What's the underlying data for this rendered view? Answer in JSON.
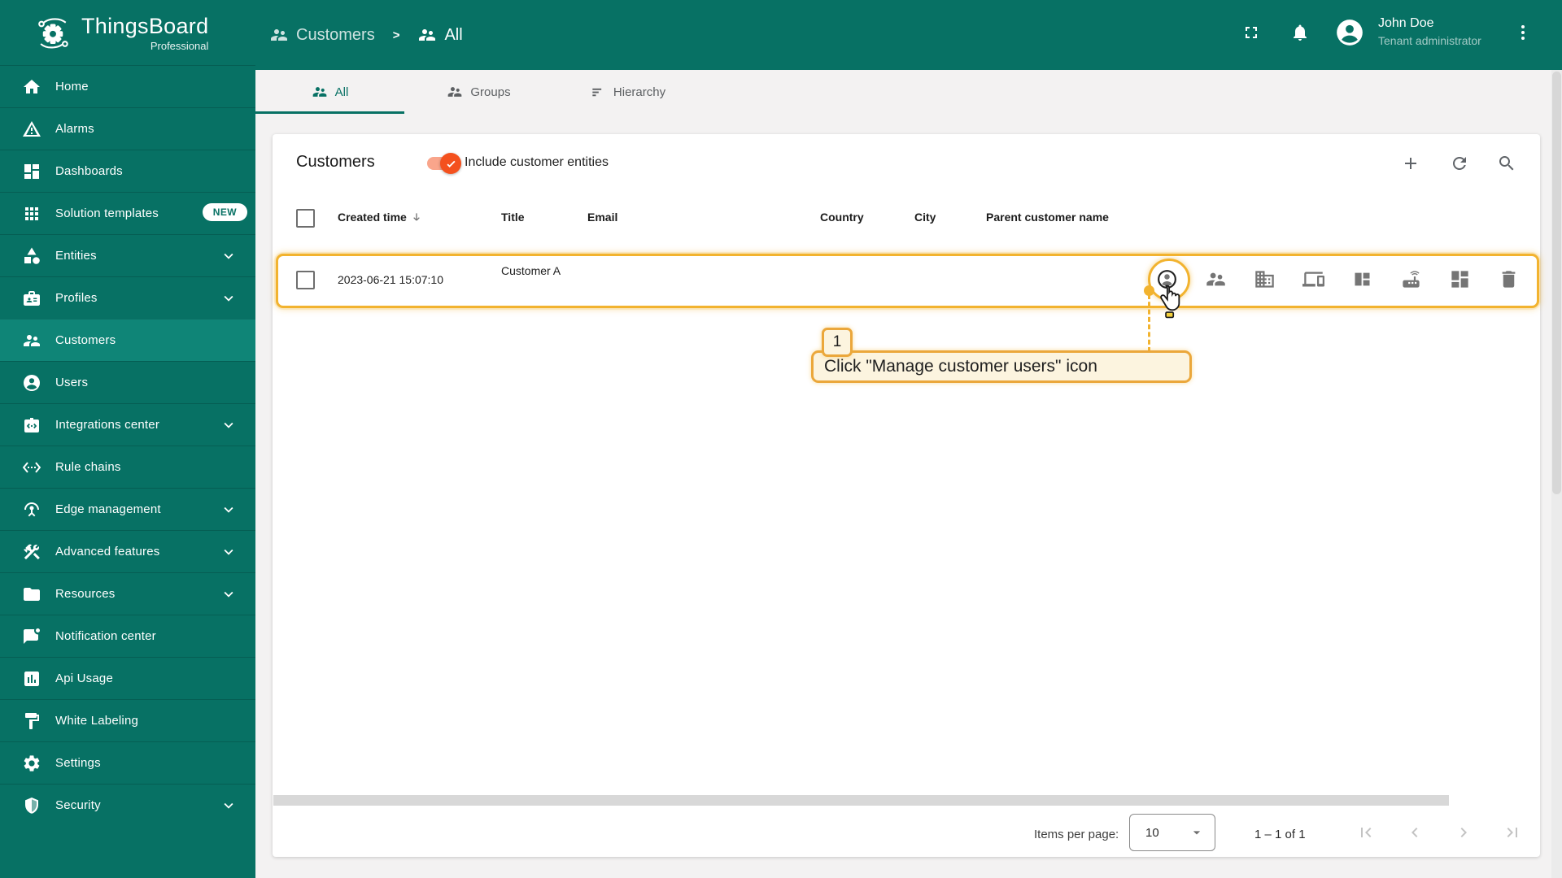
{
  "app": {
    "name": "ThingsBoard",
    "edition": "Professional"
  },
  "colors": {
    "teal": "#077164",
    "teal_active": "#0f8577",
    "accent_orange": "#f4511e",
    "toggle_track": "#f9a58b",
    "highlight_gold": "#f2b32f",
    "annotation_bg": "#fcf4df",
    "annotation_border": "#eba73b"
  },
  "sidebar": {
    "items": [
      {
        "label": "Home",
        "icon": "home-icon"
      },
      {
        "label": "Alarms",
        "icon": "warning-icon"
      },
      {
        "label": "Dashboards",
        "icon": "dashboard-icon"
      },
      {
        "label": "Solution templates",
        "icon": "apps-icon",
        "badge": "NEW"
      },
      {
        "label": "Entities",
        "icon": "shapes-icon",
        "expandable": true
      },
      {
        "label": "Profiles",
        "icon": "badge-icon",
        "expandable": true
      },
      {
        "label": "Customers",
        "icon": "people-icon",
        "active": true
      },
      {
        "label": "Users",
        "icon": "person-circle-icon"
      },
      {
        "label": "Integrations center",
        "icon": "integration-icon",
        "expandable": true
      },
      {
        "label": "Rule chains",
        "icon": "ethernet-icon"
      },
      {
        "label": "Edge management",
        "icon": "antenna-icon",
        "expandable": true
      },
      {
        "label": "Advanced features",
        "icon": "tools-icon",
        "expandable": true
      },
      {
        "label": "Resources",
        "icon": "folder-icon",
        "expandable": true
      },
      {
        "label": "Notification center",
        "icon": "chat-dot-icon"
      },
      {
        "label": "Api Usage",
        "icon": "chart-icon"
      },
      {
        "label": "White Labeling",
        "icon": "paint-icon"
      },
      {
        "label": "Settings",
        "icon": "gear-icon"
      },
      {
        "label": "Security",
        "icon": "shield-icon",
        "expandable": true
      }
    ]
  },
  "topbar": {
    "breadcrumb": {
      "root": "Customers",
      "separator": ">",
      "current": "All"
    },
    "user": {
      "name": "John Doe",
      "role": "Tenant administrator"
    }
  },
  "tabs": [
    {
      "label": "All",
      "active": true
    },
    {
      "label": "Groups",
      "active": false
    },
    {
      "label": "Hierarchy",
      "active": false
    }
  ],
  "table": {
    "title": "Customers",
    "toggle_label": "Include customer entities",
    "toggle_on": true,
    "columns": [
      "Created time",
      "Title",
      "Email",
      "Country",
      "City",
      "Parent customer name"
    ],
    "rows": [
      {
        "created_time": "2023-06-21 15:07:10",
        "title": "Customer A",
        "email": "",
        "country": "",
        "city": "",
        "parent_customer_name": ""
      }
    ],
    "row_actions": [
      "manage-customer-users",
      "manage-customer-user-groups",
      "manage-customer-assets",
      "manage-customer-devices",
      "manage-customer-dashboard-groups",
      "manage-customer-edges",
      "manage-customer-dashboards",
      "delete-customer"
    ]
  },
  "annotation": {
    "step": "1",
    "text": "Click \"Manage customer users\" icon"
  },
  "paginator": {
    "items_per_page_label": "Items per page:",
    "items_per_page_value": "10",
    "range": "1 – 1 of 1"
  }
}
